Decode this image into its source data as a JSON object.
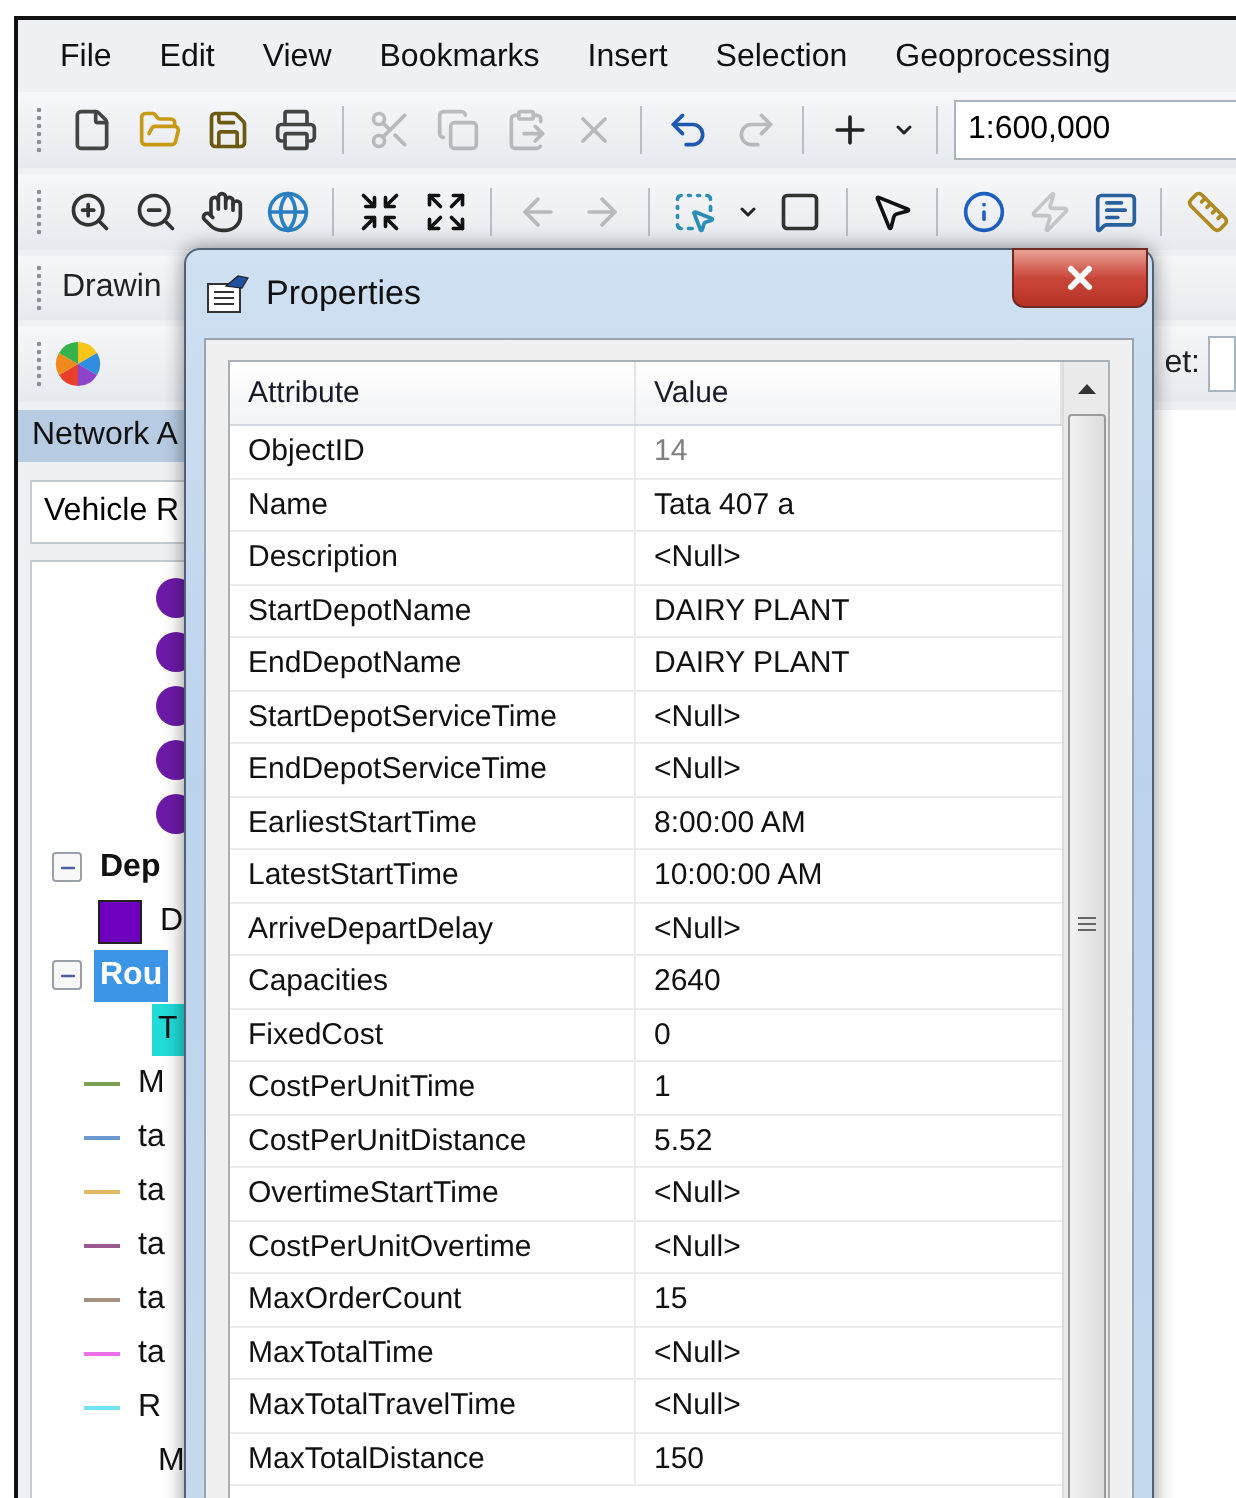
{
  "menu": [
    {
      "label": "File"
    },
    {
      "label": "Edit"
    },
    {
      "label": "View"
    },
    {
      "label": "Bookmarks"
    },
    {
      "label": "Insert"
    },
    {
      "label": "Selection"
    },
    {
      "label": "Geoprocessing"
    }
  ],
  "toolbar_1": {
    "items": [
      {
        "kind": "new",
        "disabled": false
      },
      {
        "kind": "open",
        "disabled": false
      },
      {
        "kind": "save",
        "disabled": false
      },
      {
        "kind": "print",
        "disabled": false
      },
      {
        "kind": "separator"
      },
      {
        "kind": "cut",
        "disabled": true
      },
      {
        "kind": "copy",
        "disabled": true
      },
      {
        "kind": "paste",
        "disabled": true
      },
      {
        "kind": "delete",
        "disabled": true
      },
      {
        "kind": "separator"
      },
      {
        "kind": "undo",
        "disabled": false
      },
      {
        "kind": "redo",
        "disabled": true
      },
      {
        "kind": "separator"
      },
      {
        "kind": "add-data",
        "disabled": false
      },
      {
        "kind": "caret",
        "disabled": false
      },
      {
        "kind": "separator"
      }
    ],
    "scale": "1:600,000"
  },
  "toolbar_2": {
    "items": [
      {
        "kind": "zoom-in",
        "disabled": false
      },
      {
        "kind": "zoom-out",
        "disabled": false
      },
      {
        "kind": "pan",
        "disabled": false
      },
      {
        "kind": "globe",
        "disabled": false
      },
      {
        "kind": "separator"
      },
      {
        "kind": "shrink",
        "disabled": false
      },
      {
        "kind": "expand",
        "disabled": false
      },
      {
        "kind": "separator"
      },
      {
        "kind": "back",
        "disabled": true
      },
      {
        "kind": "forward",
        "disabled": true
      },
      {
        "kind": "separator"
      },
      {
        "kind": "select-features",
        "disabled": false
      },
      {
        "kind": "caret",
        "disabled": false
      },
      {
        "kind": "clear",
        "disabled": false
      },
      {
        "kind": "separator"
      },
      {
        "kind": "pointer",
        "disabled": false
      },
      {
        "kind": "separator"
      },
      {
        "kind": "info",
        "disabled": false
      },
      {
        "kind": "lightning",
        "disabled": true
      },
      {
        "kind": "popup",
        "disabled": false
      },
      {
        "kind": "separator"
      },
      {
        "kind": "ruler",
        "disabled": false
      }
    ]
  },
  "drawing_toolbar": {
    "label": "Drawin"
  },
  "toolbar_4": {
    "label": "et:"
  },
  "network_panel": {
    "title": "Network A",
    "dropdown": "Vehicle R"
  },
  "tree": [
    {
      "kind": "order"
    },
    {
      "kind": "order"
    },
    {
      "kind": "order"
    },
    {
      "kind": "order"
    },
    {
      "kind": "order"
    },
    {
      "kind": "group",
      "label": "Dep",
      "expanded": true,
      "selected": false,
      "children": [
        {
          "kind": "fill",
          "label": "D",
          "color": "#7000c0",
          "selected": false
        }
      ]
    },
    {
      "kind": "group",
      "label": "Rou",
      "expanded": true,
      "selected": true,
      "children": [
        {
          "kind": "heading",
          "label": "T",
          "selected": true
        },
        {
          "kind": "line",
          "label": "M",
          "color": "#7aa050",
          "selected": false
        },
        {
          "kind": "line",
          "label": "ta",
          "color": "#6a9ad0",
          "selected": false
        },
        {
          "kind": "line",
          "label": "ta",
          "color": "#e0b860",
          "selected": false
        },
        {
          "kind": "line",
          "label": "ta",
          "color": "#9a5a90",
          "selected": false
        },
        {
          "kind": "line",
          "label": "ta",
          "color": "#a89080",
          "selected": false
        },
        {
          "kind": "line",
          "label": "ta",
          "color": "#ee70e8",
          "selected": false
        },
        {
          "kind": "line",
          "label": "R",
          "color": "#70e4f4",
          "selected": false
        },
        {
          "kind": "heading",
          "label": "M",
          "selected": false
        }
      ]
    }
  ],
  "dialog": {
    "title": "Properties",
    "columns": [
      "Attribute",
      "Value"
    ],
    "rows": [
      {
        "attribute": "ObjectID",
        "value": "14",
        "disabled": true
      },
      {
        "attribute": "Name",
        "value": "Tata 407 a",
        "disabled": false
      },
      {
        "attribute": "Description",
        "value": "<Null>",
        "disabled": false
      },
      {
        "attribute": "StartDepotName",
        "value": "DAIRY PLANT",
        "disabled": false
      },
      {
        "attribute": "EndDepotName",
        "value": "DAIRY PLANT",
        "disabled": false
      },
      {
        "attribute": "StartDepotServiceTime",
        "value": "<Null>",
        "disabled": false
      },
      {
        "attribute": "EndDepotServiceTime",
        "value": "<Null>",
        "disabled": false
      },
      {
        "attribute": "EarliestStartTime",
        "value": "8:00:00 AM",
        "disabled": false
      },
      {
        "attribute": "LatestStartTime",
        "value": "10:00:00 AM",
        "disabled": false
      },
      {
        "attribute": "ArriveDepartDelay",
        "value": "<Null>",
        "disabled": false
      },
      {
        "attribute": "Capacities",
        "value": "2640",
        "disabled": false
      },
      {
        "attribute": "FixedCost",
        "value": "0",
        "disabled": false
      },
      {
        "attribute": "CostPerUnitTime",
        "value": "1",
        "disabled": false
      },
      {
        "attribute": "CostPerUnitDistance",
        "value": "5.52",
        "disabled": false
      },
      {
        "attribute": "OvertimeStartTime",
        "value": "<Null>",
        "disabled": false
      },
      {
        "attribute": "CostPerUnitOvertime",
        "value": "<Null>",
        "disabled": false
      },
      {
        "attribute": "MaxOrderCount",
        "value": "15",
        "disabled": false
      },
      {
        "attribute": "MaxTotalTime",
        "value": "<Null>",
        "disabled": false
      },
      {
        "attribute": "MaxTotalTravelTime",
        "value": "<Null>",
        "disabled": false
      },
      {
        "attribute": "MaxTotalDistance",
        "value": "150",
        "disabled": false
      }
    ]
  }
}
